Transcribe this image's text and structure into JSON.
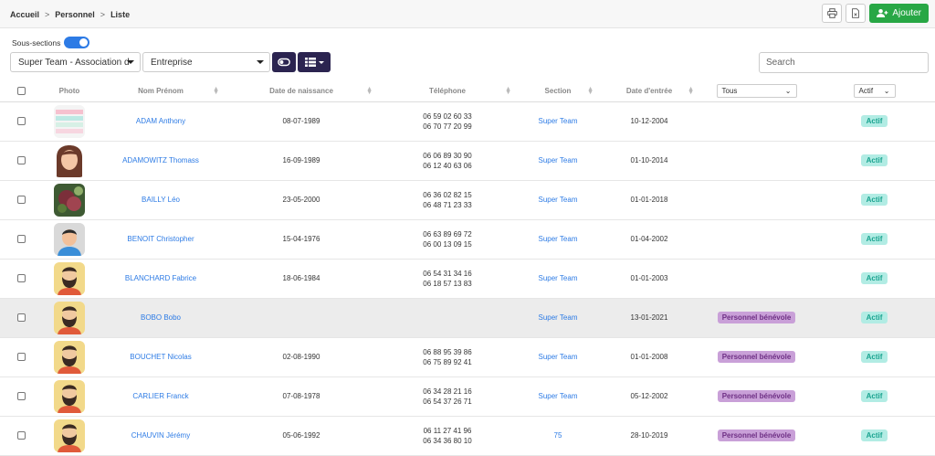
{
  "breadcrumb": {
    "item1": "Accueil",
    "item2": "Personnel",
    "item3": "Liste",
    "sep": ">"
  },
  "actions": {
    "print_icon": "printer-icon",
    "export_icon": "excel-file-icon",
    "add_label": "Ajouter",
    "add_icon": "user-plus-icon",
    "add_color": "#28a745"
  },
  "toolbar": {
    "toggle_label": "Sous-sections",
    "toggle_on": true,
    "section_select": "Super Team - Association d",
    "company_select": "Entreprise",
    "view_toggle_icon": "toggle-icon",
    "list_view_icon": "list-icon",
    "search_placeholder": "Search",
    "accent": "#2b2450"
  },
  "columns": {
    "photo": "Photo",
    "name": "Nom Prénom",
    "birth": "Date de naissance",
    "phone": "Téléphone",
    "section": "Section",
    "entry": "Date d'entrée",
    "category_filter": "Tous",
    "status_filter": "Actif"
  },
  "rows": [
    {
      "name": "ADAM Anthony",
      "birth": "08-07-1989",
      "phone1": "06 59 02 60 33",
      "phone2": "06 70 77 20 99",
      "section": "Super Team",
      "entry": "10-12-2004",
      "category": "",
      "status": "Actif",
      "photo": "swatch-image"
    },
    {
      "name": "ADAMOWITZ Thomass",
      "birth": "16-09-1989",
      "phone1": "06 06 89 30 90",
      "phone2": "06 12 40 63 06",
      "section": "Super Team",
      "entry": "01-10-2014",
      "category": "",
      "status": "Actif",
      "photo": "woman-avatar"
    },
    {
      "name": "BAILLY Léo",
      "birth": "23-05-2000",
      "phone1": "06 36 02 82 15",
      "phone2": "06 48 71 23 33",
      "section": "Super Team",
      "entry": "01-01-2018",
      "category": "",
      "status": "Actif",
      "photo": "photo"
    },
    {
      "name": "BENOIT Christopher",
      "birth": "15-04-1976",
      "phone1": "06 63 89 69 72",
      "phone2": "06 00 13 09 15",
      "section": "Super Team",
      "entry": "01-04-2002",
      "category": "",
      "status": "Actif",
      "photo": "man-avatar"
    },
    {
      "name": "BLANCHARD Fabrice",
      "birth": "18-06-1984",
      "phone1": "06 54 31 34 16",
      "phone2": "06 18 57 13 83",
      "section": "Super Team",
      "entry": "01-01-2003",
      "category": "",
      "status": "Actif",
      "photo": "bearded-avatar"
    },
    {
      "name": "BOBO Bobo",
      "birth": "",
      "phone1": "",
      "phone2": "",
      "section": "Super Team",
      "entry": "13-01-2021",
      "category": "Personnel bénévole",
      "status": "Actif",
      "photo": "bearded-avatar"
    },
    {
      "name": "BOUCHET Nicolas",
      "birth": "02-08-1990",
      "phone1": "06 88 95 39 86",
      "phone2": "06 75 89 92 41",
      "section": "Super Team",
      "entry": "01-01-2008",
      "category": "Personnel bénévole",
      "status": "Actif",
      "photo": "bearded-avatar"
    },
    {
      "name": "CARLIER Franck",
      "birth": "07-08-1978",
      "phone1": "06 34 28 21 16",
      "phone2": "06 54 37 26 71",
      "section": "Super Team",
      "entry": "05-12-2002",
      "category": "Personnel bénévole",
      "status": "Actif",
      "photo": "bearded-avatar"
    },
    {
      "name": "CHAUVIN Jérémy",
      "birth": "05-06-1992",
      "phone1": "06 11 27 41 96",
      "phone2": "06 34 36 80 10",
      "section": "75",
      "entry": "28-10-2019",
      "category": "Personnel bénévole",
      "status": "Actif",
      "photo": "bearded-avatar"
    }
  ]
}
